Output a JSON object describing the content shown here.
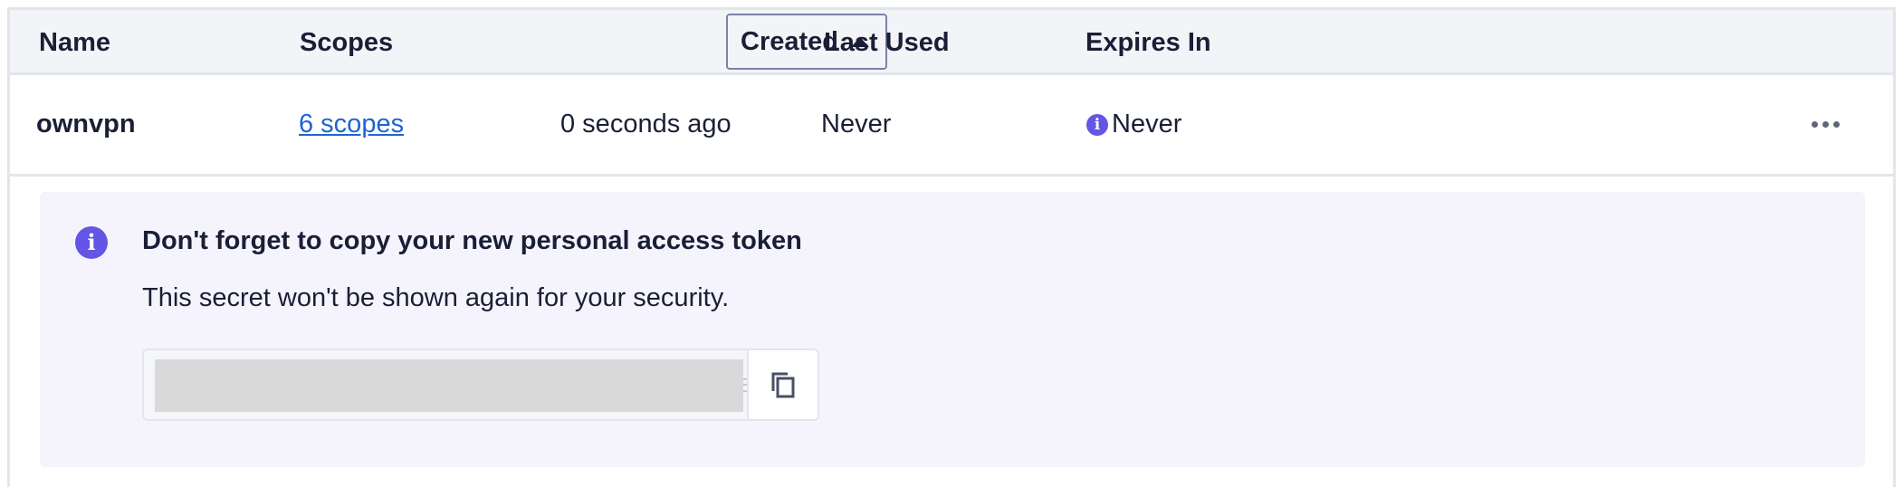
{
  "table": {
    "headers": {
      "name": "Name",
      "scopes": "Scopes",
      "created": "Created",
      "last_used": "Last Used",
      "expires_in": "Expires In"
    },
    "sort": {
      "column": "created",
      "direction": "ascending",
      "icon": "caret-up-icon"
    },
    "rows": [
      {
        "name": "ownvpn",
        "scopes": "6 scopes",
        "created": "0 seconds ago",
        "last_used": "Never",
        "expires_in": "Never",
        "expires_icon": "info-icon",
        "actions_icon": "more-horizontal-icon"
      }
    ]
  },
  "notice": {
    "icon": "info-icon",
    "title": "Don't forget to copy your new personal access token",
    "body": "This secret won't be shown again for your security.",
    "token_value_visible_fragment": "ec",
    "copy_icon": "copy-icon"
  },
  "colors": {
    "accent": "#6356e5",
    "link": "#1f63d6",
    "header_bg": "#f3f4f8",
    "notice_bg": "#f5f4fd",
    "text": "#1a1f36"
  }
}
